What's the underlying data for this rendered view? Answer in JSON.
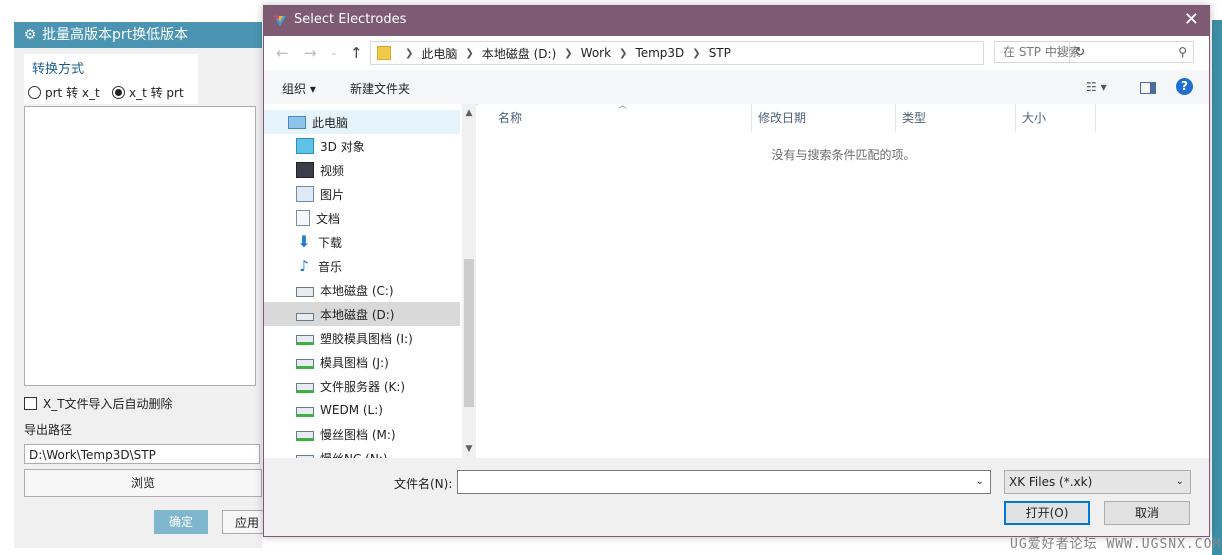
{
  "tool": {
    "title": "批量高版本prt换低版本",
    "conversion_group": "转换方式",
    "radio_prt_to_xt": "prt 转 x_t",
    "radio_xt_to_prt": "x_t 转 prt",
    "selected_mode": "x_t 转 prt",
    "auto_delete_label": "X_T文件导入后自动删除",
    "auto_delete_checked": false,
    "export_label": "导出路径",
    "export_path": "D:\\Work\\Temp3D\\STP",
    "browse_label": "浏览",
    "ok_label": "确定",
    "apply_label": "应用",
    "accent_color": "#4b95b2"
  },
  "watermark": "UG爱好者论坛 WWW.UGSNX.COM",
  "dialog": {
    "title": "Select Electrodes",
    "titlebar_color": "#7e5b73",
    "breadcrumb": [
      "此电脑",
      "本地磁盘 (D:)",
      "Work",
      "Temp3D",
      "STP"
    ],
    "search_placeholder": "在 STP 中搜索",
    "organize_label": "组织 ▾",
    "new_folder_label": "新建文件夹",
    "nav_items": [
      {
        "label": "此电脑",
        "icon": "computer-icon"
      },
      {
        "label": "3D 对象",
        "icon": "3d-objects-icon"
      },
      {
        "label": "视频",
        "icon": "video-icon"
      },
      {
        "label": "图片",
        "icon": "pictures-icon"
      },
      {
        "label": "文档",
        "icon": "documents-icon"
      },
      {
        "label": "下载",
        "icon": "download-icon"
      },
      {
        "label": "音乐",
        "icon": "music-icon"
      },
      {
        "label": "本地磁盘 (C:)",
        "icon": "drive-c-icon"
      },
      {
        "label": "本地磁盘 (D:)",
        "icon": "drive-icon"
      },
      {
        "label": "塑胶模具图档 (I:)",
        "icon": "network-drive-icon"
      },
      {
        "label": "模具图档 (J:)",
        "icon": "network-drive-icon"
      },
      {
        "label": "文件服务器 (K:)",
        "icon": "network-drive-icon"
      },
      {
        "label": "WEDM (L:)",
        "icon": "network-drive-icon"
      },
      {
        "label": "慢丝图档 (M:)",
        "icon": "network-drive-icon"
      },
      {
        "label": "慢丝NC (N:)",
        "icon": "network-drive-icon"
      }
    ],
    "columns": [
      "名称",
      "修改日期",
      "类型",
      "大小"
    ],
    "empty_message": "没有与搜索条件匹配的项。",
    "filename_label": "文件名(N):",
    "filename_value": "",
    "filter_value": "XK Files (*.xk)",
    "open_label": "打开(O)",
    "cancel_label": "取消"
  }
}
